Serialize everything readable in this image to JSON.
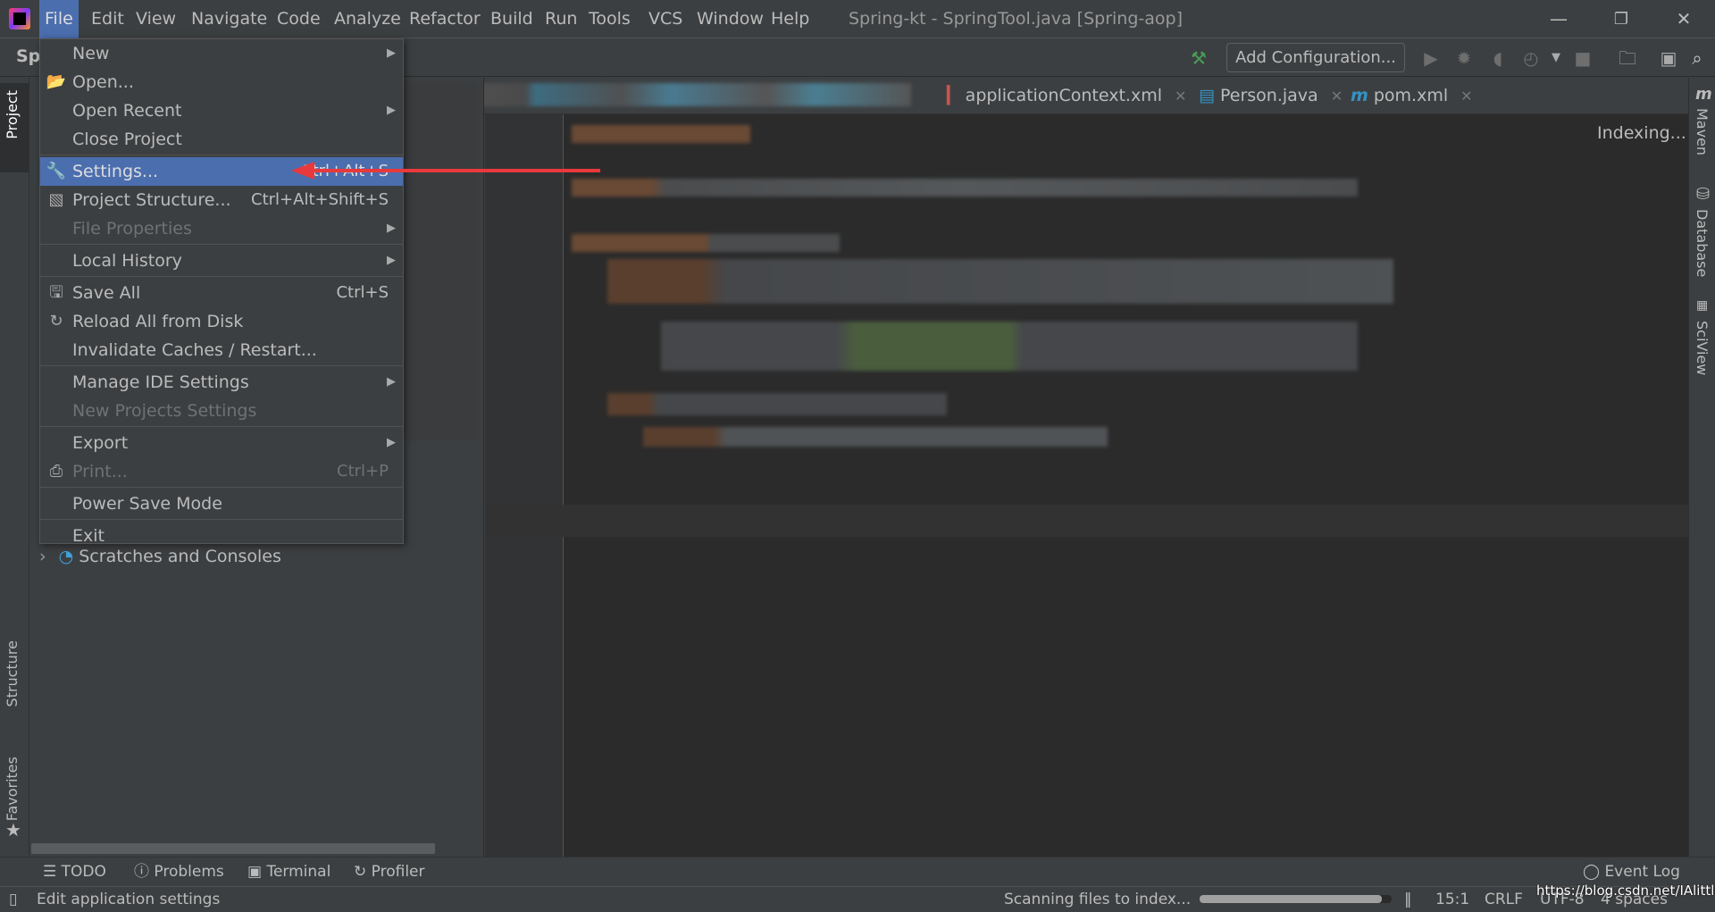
{
  "menubar": {
    "items": [
      "File",
      "Edit",
      "View",
      "Navigate",
      "Code",
      "Analyze",
      "Refactor",
      "Build",
      "Run",
      "Tools",
      "VCS",
      "Window",
      "Help"
    ],
    "active": "File"
  },
  "window": {
    "title": "Spring-kt - SpringTool.java [Spring-aop]",
    "minimize": "—",
    "restore": "❐",
    "close": "✕"
  },
  "toolbar": {
    "breadcrumb": "Sp",
    "add_configuration": "Add Configuration..."
  },
  "tabs": [
    {
      "label": "applicationContext.xml",
      "icon": "xml-file-icon"
    },
    {
      "label": "Person.java",
      "icon": "java-file-icon"
    },
    {
      "label": "pom.xml",
      "icon": "maven-icon"
    }
  ],
  "left_strip": {
    "project": "Project",
    "structure": "Structure",
    "favorites": "Favorites"
  },
  "right_strip": {
    "maven": "Maven",
    "database": "Database",
    "sciview": "SciView"
  },
  "editor": {
    "status": "Indexing..."
  },
  "file_menu": {
    "items": [
      {
        "label": "New",
        "submenu": true
      },
      {
        "label": "Open...",
        "icon": "folder-open-icon"
      },
      {
        "label": "Open Recent",
        "submenu": true
      },
      {
        "label": "Close Project"
      },
      {
        "sep": true
      },
      {
        "label": "Settings...",
        "icon": "wrench-icon",
        "shortcut": "Ctrl+Alt+S",
        "selected": true
      },
      {
        "label": "Project Structure...",
        "icon": "project-structure-icon",
        "shortcut": "Ctrl+Alt+Shift+S"
      },
      {
        "label": "File Properties",
        "submenu": true,
        "disabled": true
      },
      {
        "sep": true
      },
      {
        "label": "Local History",
        "submenu": true
      },
      {
        "sep": true
      },
      {
        "label": "Save All",
        "icon": "save-icon",
        "shortcut": "Ctrl+S"
      },
      {
        "label": "Reload All from Disk",
        "icon": "reload-icon"
      },
      {
        "label": "Invalidate Caches / Restart..."
      },
      {
        "sep": true
      },
      {
        "label": "Manage IDE Settings",
        "submenu": true
      },
      {
        "label": "New Projects Settings",
        "disabled": true
      },
      {
        "sep": true
      },
      {
        "label": "Export",
        "submenu": true
      },
      {
        "label": "Print...",
        "icon": "print-icon",
        "shortcut": "Ctrl+P",
        "disabled": true
      },
      {
        "sep": true
      },
      {
        "label": "Power Save Mode"
      },
      {
        "sep": true
      },
      {
        "label": "Exit"
      }
    ]
  },
  "project_tree": {
    "scratches": "Scratches and Consoles"
  },
  "bottom_tools": {
    "todo": "TODO",
    "problems": "Problems",
    "terminal": "Terminal",
    "profiler": "Profiler",
    "event_log": "Event Log"
  },
  "status": {
    "hint": "Edit application settings",
    "progress_text": "Scanning files to index...",
    "progress": 0.95,
    "position": "15:1",
    "line_sep": "CRLF",
    "encoding": "UTF-8",
    "indent": "4 spaces",
    "watermark": "https://blog.csdn.net/IAlittle"
  },
  "colors": {
    "selection": "#4b6eaf",
    "arrow": "#e8393c",
    "background": "#3c3f41",
    "editor": "#2b2b2b"
  }
}
